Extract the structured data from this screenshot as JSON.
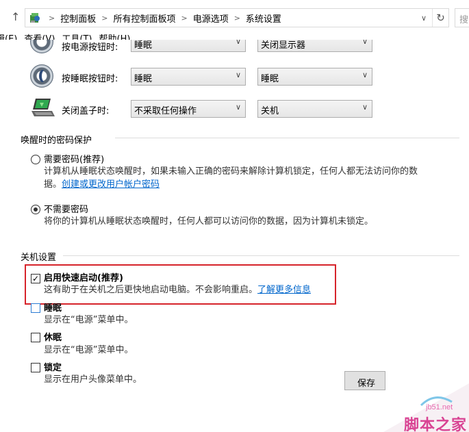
{
  "addressbar": {
    "up_glyph": "↑",
    "breadcrumbs": [
      "控制面板",
      "所有控制面板项",
      "电源选项",
      "系统设置"
    ],
    "separator": ">",
    "dropdown_glyph": "∨",
    "refresh_glyph": "↻",
    "search_placeholder": "搜"
  },
  "menubar": {
    "items": [
      "辑(E)",
      "查看(V)",
      "工具(T)",
      "帮助(H)"
    ]
  },
  "power_buttons": {
    "rows": [
      {
        "label": "按电源按钮时:",
        "battery": "睡眠",
        "plugged": "关闭显示器"
      },
      {
        "label": "按睡眠按钮时:",
        "battery": "睡眠",
        "plugged": "睡眠"
      },
      {
        "label": "关闭盖子时:",
        "battery": "不采取任何操作",
        "plugged": "关机"
      }
    ]
  },
  "password_group": {
    "heading": "唤醒时的密码保护",
    "require": {
      "title": "需要密码(推荐)",
      "desc_line1": "计算机从睡眠状态唤醒时，如果未输入正确的密码来解除计算机锁定，任何人都无法访问你的数",
      "desc_line2_prefix": "据。",
      "link": "创建或更改用户帐户密码",
      "selected": false
    },
    "no_require": {
      "title": "不需要密码",
      "desc": "将你的计算机从睡眠状态唤醒时，任何人都可以访问你的数据，因为计算机未锁定。",
      "selected": true
    }
  },
  "shutdown_group": {
    "heading": "关机设置",
    "fast_startup": {
      "title": "启用快速启动(推荐)",
      "desc": "这有助于在关机之后更快地启动电脑。不会影响重启。",
      "link": "了解更多信息",
      "checked": true
    },
    "sleep": {
      "title": "睡眠",
      "desc": "显示在“电源”菜单中。",
      "checked": false
    },
    "hibernate": {
      "title": "休眠",
      "desc": "显示在“电源”菜单中。",
      "checked": false
    },
    "lock": {
      "title": "锁定",
      "desc": "显示在用户头像菜单中。",
      "checked": false
    }
  },
  "footer": {
    "save_label": "保存"
  },
  "watermark": {
    "url": "jb51.net",
    "text": "脚本之家"
  },
  "colors": {
    "highlight": "#d6232a",
    "link": "#0066cc"
  }
}
